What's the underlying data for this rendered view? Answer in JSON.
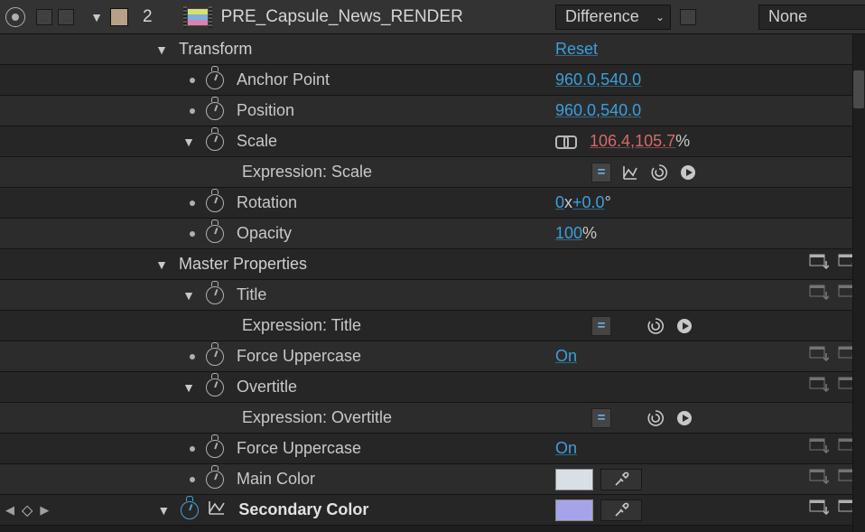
{
  "header": {
    "index": "2",
    "comp_name": "PRE_Capsule_News_RENDER",
    "blend_mode": "Difference",
    "parent": "None",
    "chip_color": "#b5a286"
  },
  "transform": {
    "label": "Transform",
    "reset": "Reset",
    "anchor": {
      "label": "Anchor Point",
      "x": "960.0",
      "y": "540.0"
    },
    "position": {
      "label": "Position",
      "x": "960.0",
      "y": "540.0"
    },
    "scale": {
      "label": "Scale",
      "x": "106.4",
      "y": "105.7",
      "unit": "%",
      "expr_label": "Expression: Scale"
    },
    "rotation": {
      "label": "Rotation",
      "turns": "0",
      "turns_unit": "x",
      "deg": "+0.0",
      "deg_unit": "°"
    },
    "opacity": {
      "label": "Opacity",
      "value": "100",
      "unit": "%"
    }
  },
  "master": {
    "label": "Master Properties",
    "title": {
      "label": "Title",
      "expr_label": "Expression: Title"
    },
    "force_upper": {
      "label": "Force Uppercase",
      "value": "On"
    },
    "overtitle": {
      "label": "Overtitle",
      "expr_label": "Expression: Overtitle"
    },
    "force_upper2": {
      "label": "Force Uppercase",
      "value": "On"
    },
    "main_color": {
      "label": "Main Color",
      "value": "#d9e0e4"
    },
    "secondary_color": {
      "label": "Secondary Color",
      "value": "#a6a4e8"
    }
  }
}
